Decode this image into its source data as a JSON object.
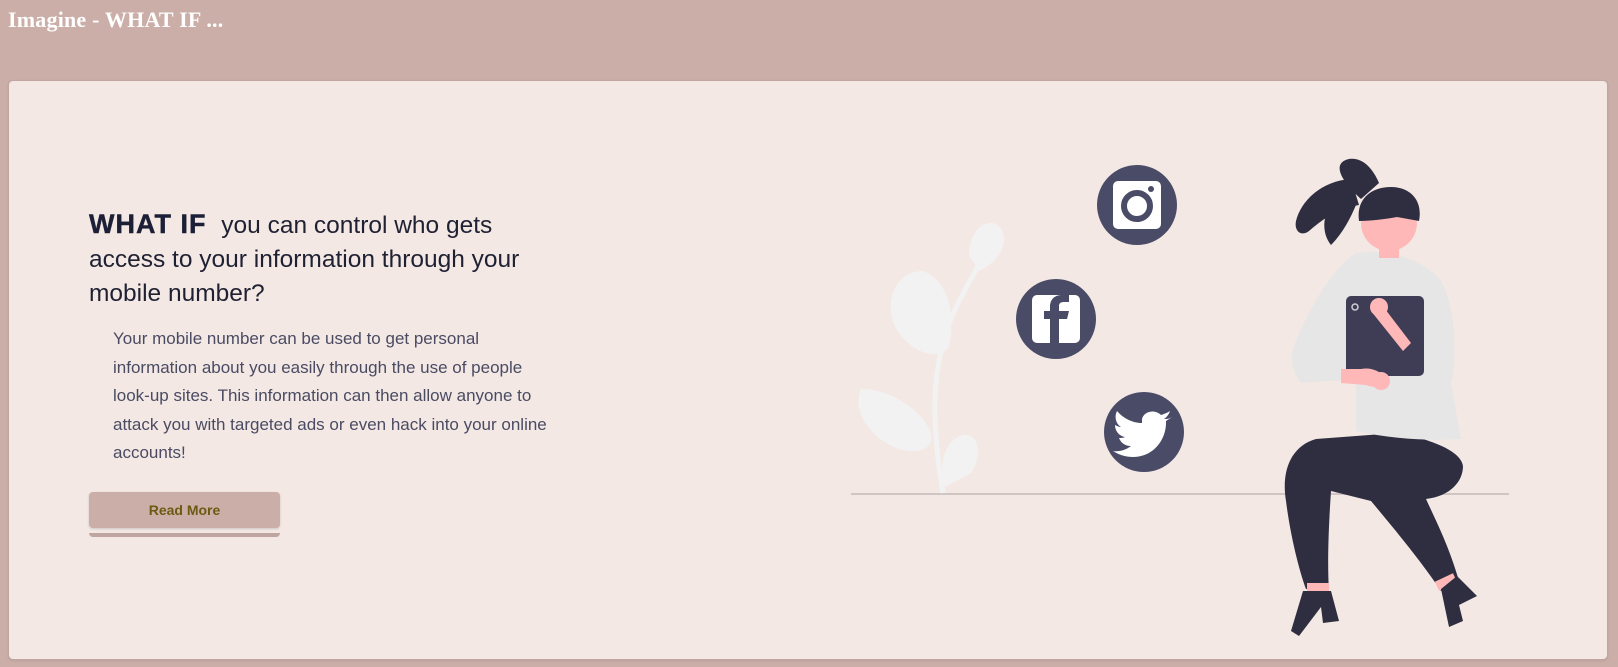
{
  "header": {
    "site_title": "Imagine - WHAT IF ..."
  },
  "hero": {
    "headline_emphasis": "WHAT IF",
    "headline_rest": "you can control who gets access to your information through your mobile number?",
    "body": "Your mobile number can be used to get personal information about you easily through the use of people look-up sites. This information can then allow anyone to attack you with targeted ads or even hack into your online accounts!",
    "read_more_label": "Read More"
  },
  "illustration": {
    "social_icons": [
      "instagram-icon",
      "facebook-icon",
      "twitter-icon"
    ]
  },
  "colors": {
    "page_background": "#cbaea8",
    "card_background": "#f3e8e4",
    "button_background": "#cbaea8",
    "button_text": "#6c5a12",
    "headline_text": "#1f2133",
    "body_text": "#4a4b63",
    "icon_circle": "#4a4b66",
    "figure_dark": "#2f2e41",
    "figure_skin": "#ffb8b8",
    "figure_shirt": "#e6e6e6"
  }
}
